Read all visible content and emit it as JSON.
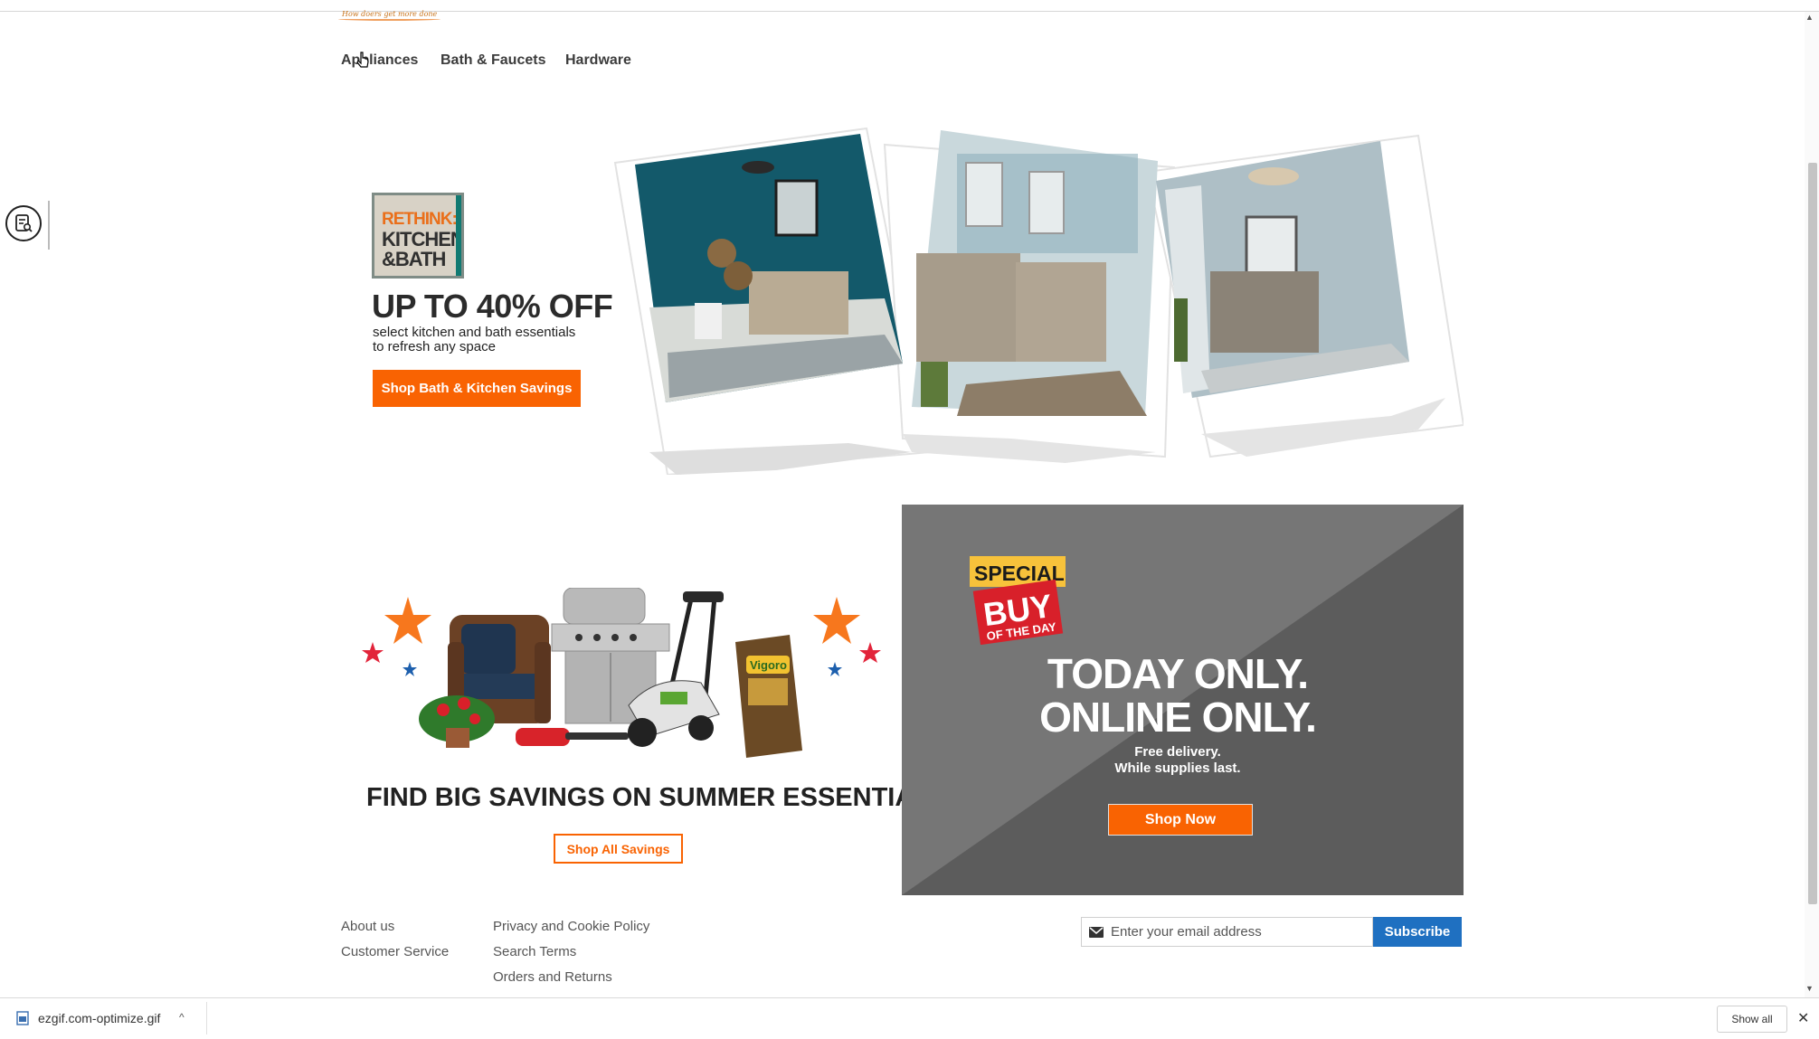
{
  "header": {
    "logo_tagline": "How doers get more done",
    "nav": [
      {
        "label": "Appliances"
      },
      {
        "label": "Bath & Faucets"
      },
      {
        "label": "Hardware"
      }
    ]
  },
  "rethink_promo": {
    "logo_line1": "RETHINK:",
    "logo_line2": "KITCHEN",
    "logo_line3": "&BATH",
    "headline": "UP TO 40% OFF",
    "subtext_line1": "select kitchen and bath essentials",
    "subtext_line2": "to refresh any space",
    "button_label": "Shop Bath & Kitchen Savings"
  },
  "summer_promo": {
    "headline": "FIND BIG SAVINGS ON SUMMER ESSENTIALS",
    "bag_brand": "Vigoro",
    "button_label": "Shop All Savings"
  },
  "special_buy": {
    "badge_line1": "SPECIAL",
    "badge_line2": "BUY",
    "badge_line3": "OF THE DAY",
    "headline_line1": "TODAY ONLY.",
    "headline_line2": "ONLINE ONLY.",
    "sub_line1": "Free delivery.",
    "sub_line2": "While supplies last.",
    "button_label": "Shop Now"
  },
  "footer": {
    "col1": [
      {
        "label": "About us"
      },
      {
        "label": "Customer Service"
      }
    ],
    "col2": [
      {
        "label": "Privacy and Cookie Policy"
      },
      {
        "label": "Search Terms"
      },
      {
        "label": "Orders and Returns"
      }
    ],
    "email_placeholder": "Enter your email address",
    "subscribe_label": "Subscribe"
  },
  "download_bar": {
    "filename": "ezgif.com-optimize.gif",
    "show_all_label": "Show all"
  },
  "colors": {
    "brand_orange": "#f96302",
    "subscribe_blue": "#1f70c1",
    "special_dark": "#5c5c5c",
    "special_light": "#767676"
  },
  "icons": [
    "cursor-icon",
    "notes-search-icon",
    "mail-icon",
    "image-file-icon",
    "chevron-up-icon",
    "close-icon"
  ]
}
